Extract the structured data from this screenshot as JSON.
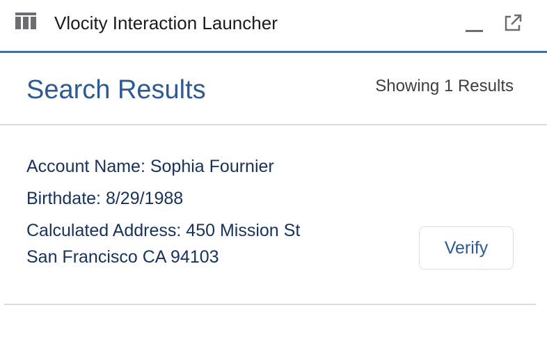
{
  "window": {
    "title": "Vlocity Interaction Launcher",
    "accent_color": "#2e73c9"
  },
  "results": {
    "title": "Search Results",
    "count_text": "Showing 1 Results"
  },
  "record": {
    "account_name": "Account Name: Sophia Fournier",
    "birthdate": "Birthdate: 8/29/1988",
    "address_line1": "Calculated Address: 450 Mission St",
    "address_line2": "San Francisco CA 94103",
    "verify_label": "Verify"
  },
  "icons": {
    "app": "table-columns-icon",
    "minimize": "minimize-icon",
    "popout": "external-link-icon"
  }
}
